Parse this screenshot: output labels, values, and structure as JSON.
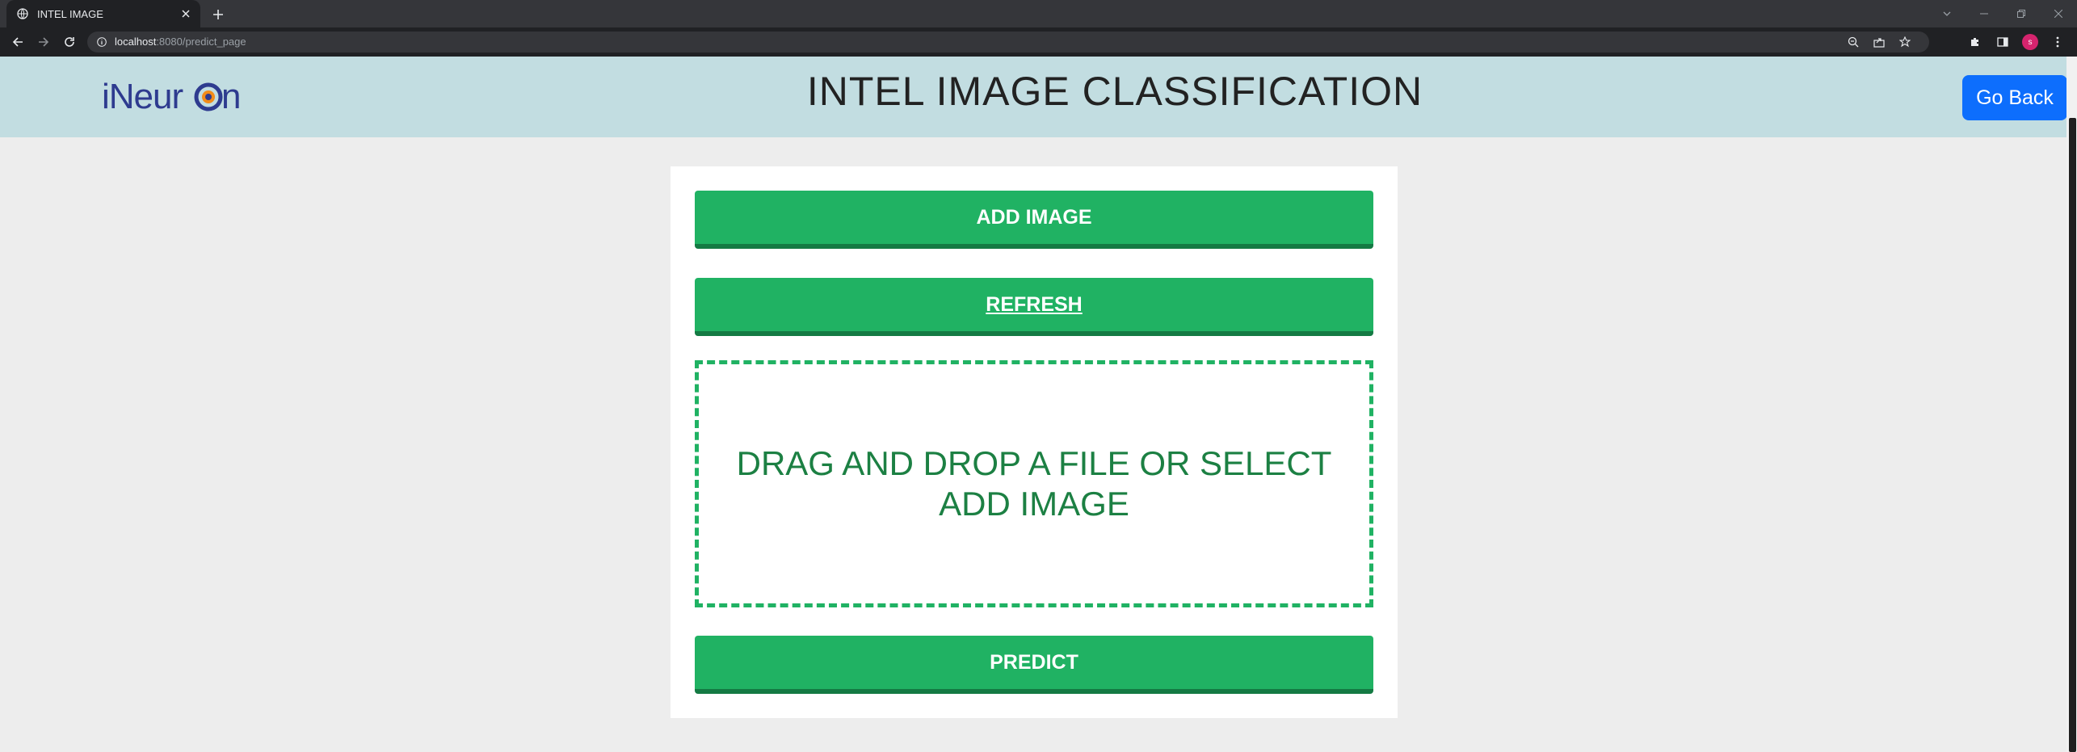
{
  "browser": {
    "tab_title": "INTEL IMAGE",
    "url_host": "localhost",
    "url_rest": ":8080/predict_page",
    "avatar_letter": "s"
  },
  "header": {
    "logo_text": "iNeuron",
    "title": "INTEL IMAGE CLASSIFICATION",
    "go_back_label": "Go Back"
  },
  "card": {
    "add_image_label": "ADD IMAGE",
    "refresh_label": "REFRESH",
    "dropzone_line1": "DRAG AND DROP A FILE OR SELECT",
    "dropzone_line2": "ADD IMAGE",
    "predict_label": "PREDICT"
  },
  "colors": {
    "header_bg": "#c2dde1",
    "button_green": "#20b263",
    "go_back_blue": "#0d6efd",
    "dropzone_text": "#1c8043"
  }
}
